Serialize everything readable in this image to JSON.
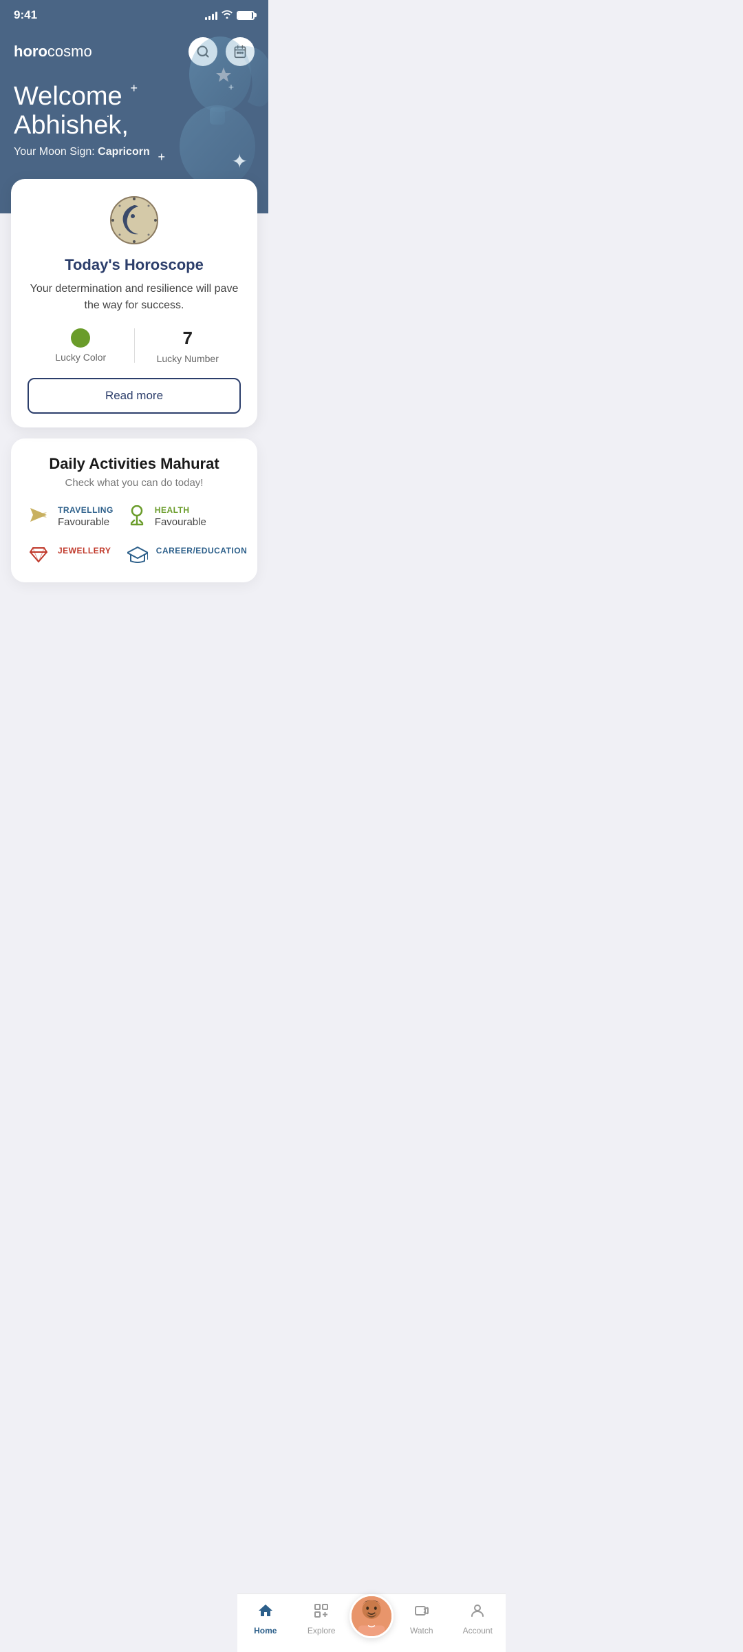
{
  "status": {
    "time": "9:41",
    "signal": [
      3,
      5,
      8,
      11,
      14
    ],
    "battery_pct": 90
  },
  "header": {
    "logo_bold": "horo",
    "logo_light": "cosmo"
  },
  "hero": {
    "welcome": "Welcome",
    "name": "Abhishek,",
    "moon_sign_label": "Your Moon Sign: ",
    "moon_sign_value": "Capricorn"
  },
  "horoscope": {
    "title": "Today's Horoscope",
    "description": "Your determination and resilience will pave the way for success.",
    "lucky_color_label": "Lucky Color",
    "lucky_color_hex": "#6a9c2a",
    "lucky_number_value": "7",
    "lucky_number_label": "Lucky Number",
    "read_more_label": "Read more"
  },
  "activities": {
    "title": "Daily Activities Mahurat",
    "subtitle": "Check what you can do today!",
    "items": [
      {
        "id": "travelling",
        "icon": "✈",
        "name": "TRAVELLING",
        "status": "Favourable"
      },
      {
        "id": "health",
        "icon": "🩺",
        "name": "HEALTH",
        "status": "Favourable"
      },
      {
        "id": "jewellery",
        "icon": "💎",
        "name": "JEWELLERY",
        "status": ""
      },
      {
        "id": "career",
        "icon": "🎓",
        "name": "CAREER/EDUCATION",
        "status": ""
      }
    ]
  },
  "nav": {
    "items": [
      {
        "id": "home",
        "label": "Home",
        "icon": "🏠",
        "active": true
      },
      {
        "id": "explore",
        "label": "Explore",
        "icon": "⊞+",
        "active": false
      },
      {
        "id": "profile",
        "label": "",
        "icon": "👤",
        "active": false,
        "is_center": true
      },
      {
        "id": "watch",
        "label": "Watch",
        "icon": "📹",
        "active": false
      },
      {
        "id": "account",
        "label": "Account",
        "icon": "👤",
        "active": false
      }
    ]
  }
}
